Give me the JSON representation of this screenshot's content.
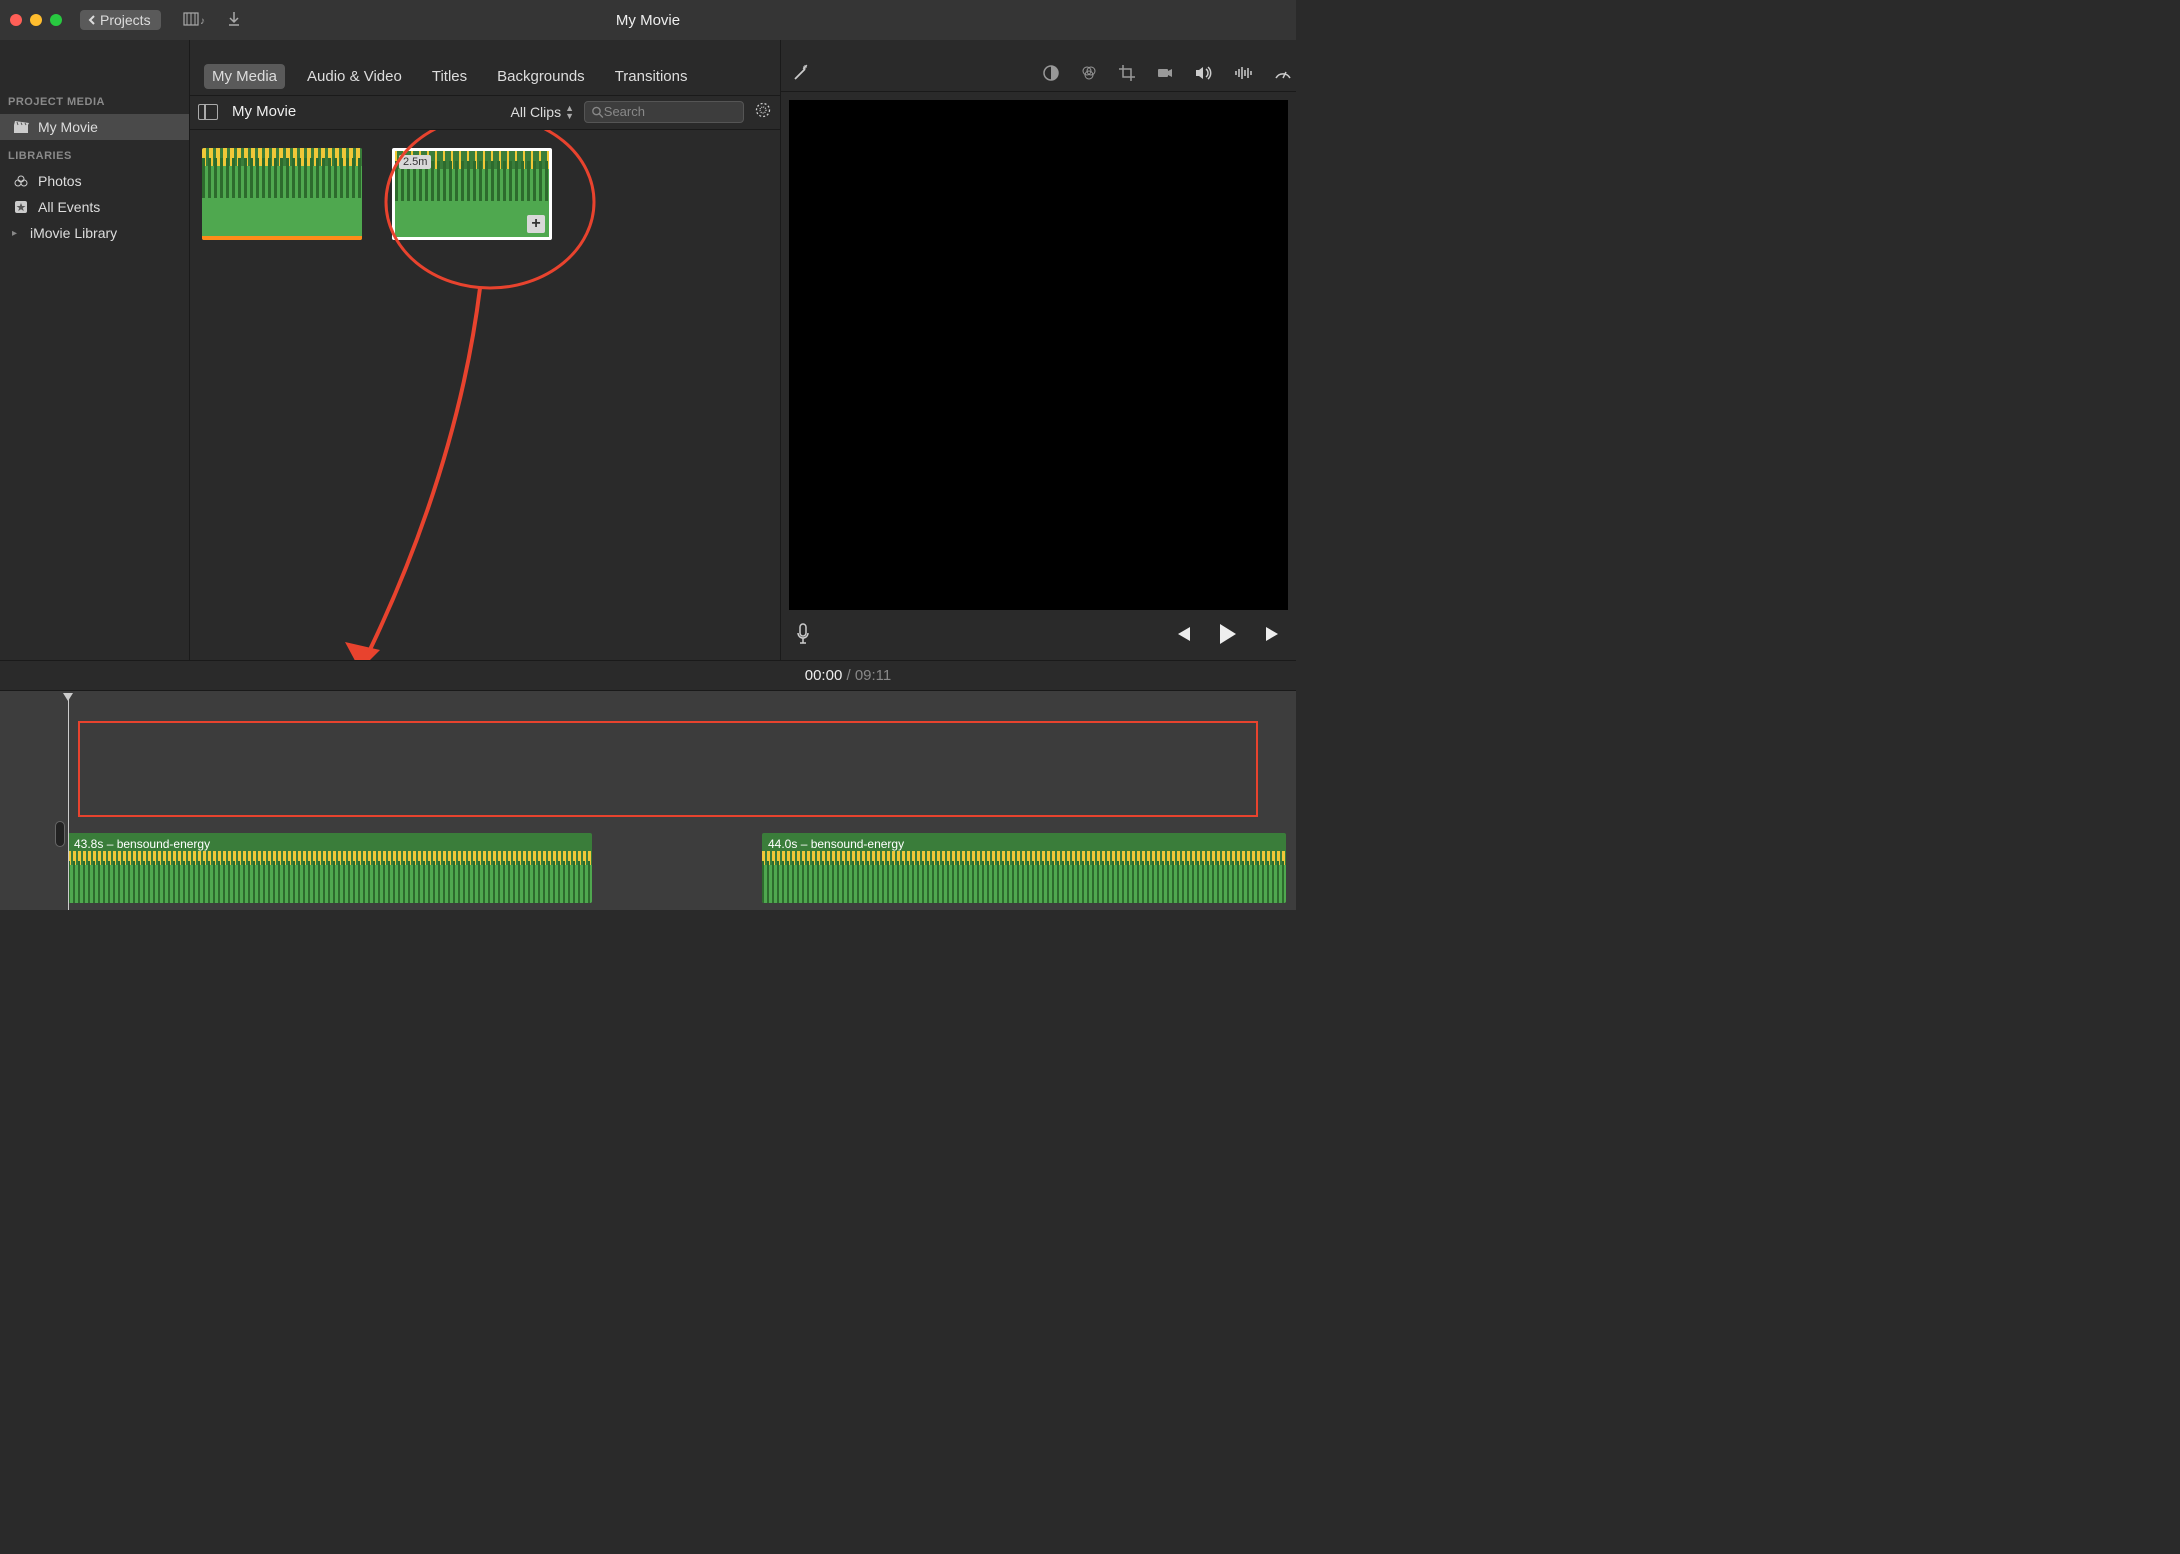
{
  "titlebar": {
    "back_button": "Projects",
    "title": "My Movie"
  },
  "tabs": {
    "my_media": "My Media",
    "audio_video": "Audio & Video",
    "titles": "Titles",
    "backgrounds": "Backgrounds",
    "transitions": "Transitions"
  },
  "sidebar": {
    "section_project": "PROJECT MEDIA",
    "project_name": "My Movie",
    "section_libraries": "LIBRARIES",
    "photos": "Photos",
    "all_events": "All Events",
    "imovie_library": "iMovie Library"
  },
  "browser": {
    "title": "My Movie",
    "clips_dropdown": "All Clips",
    "search_placeholder": "Search",
    "clip2_duration": "2.5m"
  },
  "timecode": {
    "current": "00:00",
    "separator": " / ",
    "total": "09:11"
  },
  "timeline": {
    "track1_label": "43.8s – bensound-energy",
    "track2_label": "44.0s – bensound-energy"
  }
}
